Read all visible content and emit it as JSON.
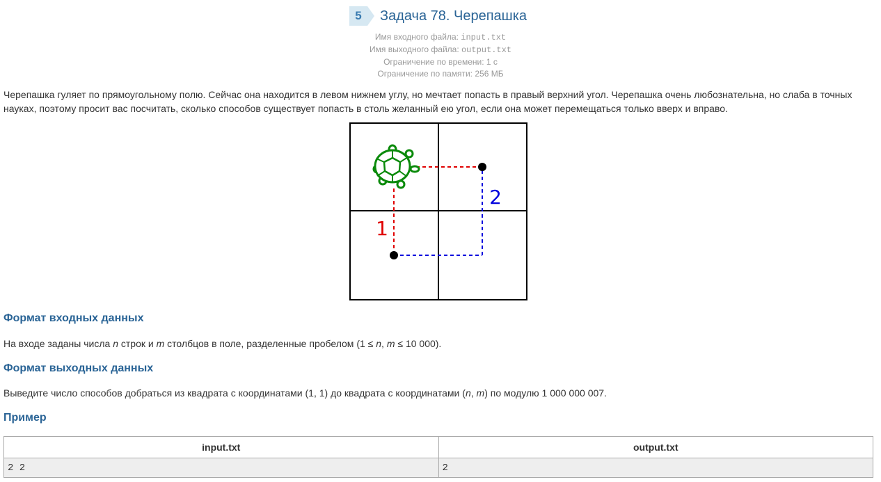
{
  "header": {
    "badge": "5",
    "title": "Задача 78. Черепашка"
  },
  "limits": {
    "input_label": "Имя входного файла: ",
    "input_file": "input.txt",
    "output_label": "Имя выходного файла: ",
    "output_file": "output.txt",
    "time": "Ограничение по времени: 1 с",
    "memory": "Ограничение по памяти: 256 МБ"
  },
  "statement": "Черепашка гуляет по прямоугольному полю. Сейчас она находится в левом нижнем углу, но мечтает попасть в правый верхний угол. Черепашка очень любознательна, но слаба в точных науках, поэтому просит вас посчитать, сколько способов существует попасть в столь желанный ею угол, если она может перемещаться только вверх и вправо.",
  "figure": {
    "label_1": "1",
    "label_2": "2",
    "path_1_color": "#e00000",
    "path_2_color": "#0000dd",
    "turtle_color": "#0a8a0a"
  },
  "input_section": {
    "heading": "Формат входных данных",
    "p1": "На входе заданы числа ",
    "n": "n",
    "p2": " строк и ",
    "m": "m",
    "p3": " столбцов в поле, разделенные пробелом (1 ≤ ",
    "n2": "n",
    "p4": ", ",
    "m2": "m",
    "p5": " ≤ 10 000)."
  },
  "output_section": {
    "heading": "Формат выходных данных",
    "p1": "Выведите число способов добраться из квадрата с координатами (1, 1) до квадрата с координатами (",
    "n": "n",
    "p2": ", ",
    "m": "m",
    "p3": ") по модулю 1 000 000 007."
  },
  "example": {
    "heading": "Пример",
    "col_input": "input.txt",
    "col_output": "output.txt",
    "input_value": "2 2",
    "output_value": "2"
  }
}
